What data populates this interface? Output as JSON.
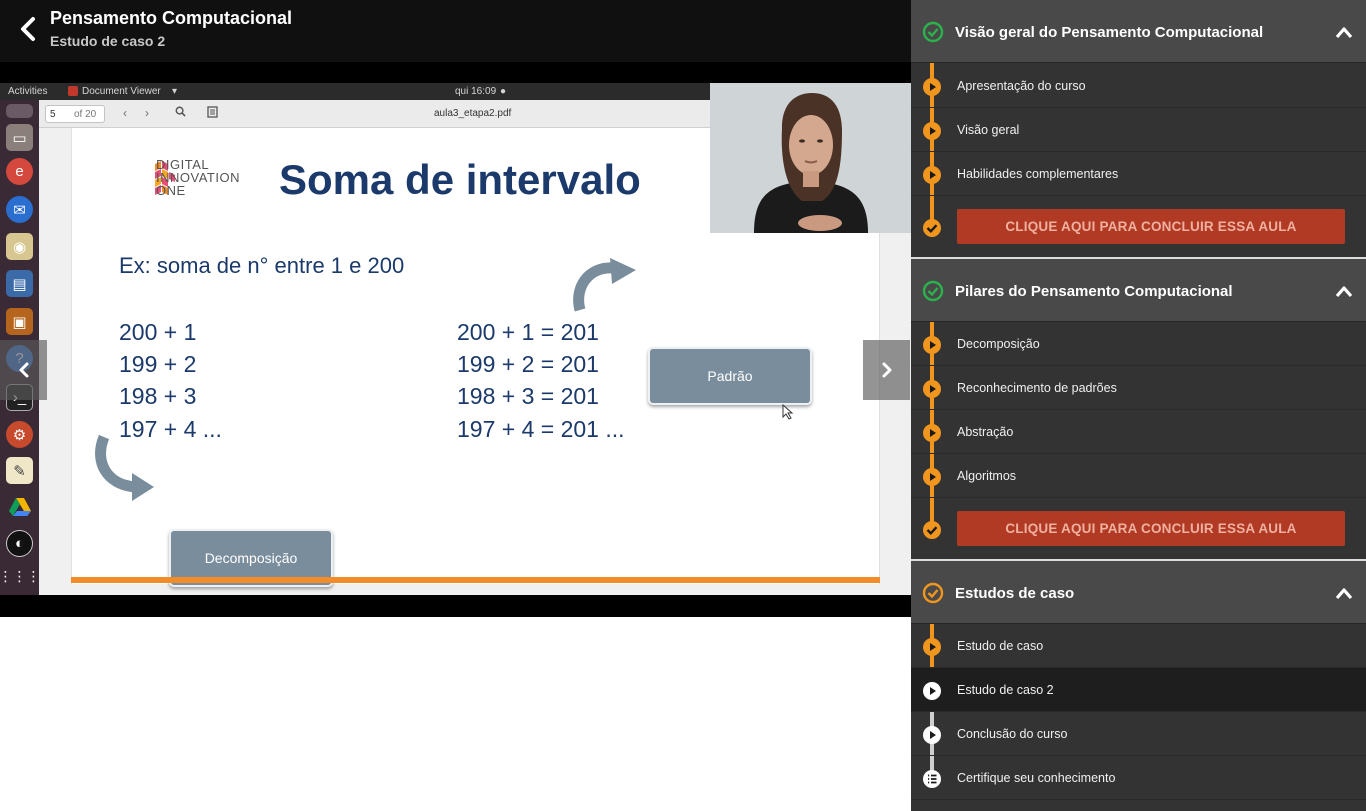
{
  "header": {
    "course_title": "Pensamento Computacional",
    "lesson_subtitle": "Estudo de caso 2"
  },
  "video": {
    "desktop_topbar": {
      "activities": "Activities",
      "app_name": "Document Viewer",
      "clock": "qui 16:09"
    },
    "viewer": {
      "page_number": "5",
      "page_total": "of 20",
      "file_name": "aula3_etapa2.pdf"
    },
    "slide": {
      "logo_lines": [
        "DIGITAL",
        "INNOVATION",
        "ONE"
      ],
      "title": "Soma de intervalo",
      "example": "Ex: soma de n° entre  1 e 200",
      "left_equations": [
        "200 + 1",
        "199 + 2",
        "198 + 3",
        "197 + 4 ..."
      ],
      "right_equations": [
        "200 + 1 = 201",
        "199 + 2 = 201",
        "198 + 3 = 201",
        "197 + 4 = 201 ..."
      ],
      "box_padrao": "Padrão",
      "box_decomposicao": "Decomposição"
    }
  },
  "sidebar": {
    "modules": [
      {
        "title": "Visão geral do Pensamento Computacional",
        "lessons": [
          "Apresentação do curso",
          "Visão geral",
          "Habilidades complementares"
        ],
        "complete_label": "CLIQUE AQUI PARA CONCLUIR ESSA AULA"
      },
      {
        "title": "Pilares do Pensamento Computacional",
        "lessons": [
          "Decomposição",
          "Reconhecimento de padrões",
          "Abstração",
          "Algoritmos"
        ],
        "complete_label": "CLIQUE AQUI PARA CONCLUIR ESSA AULA"
      },
      {
        "title": "Estudos de caso",
        "lessons": [
          "Estudo de caso",
          "Estudo de caso 2",
          "Conclusão do curso",
          "Certifique seu conhecimento"
        ]
      }
    ]
  },
  "colors": {
    "accent_orange": "#f0961e",
    "complete_green": "#2bb24c",
    "complete_button": "#b03a24",
    "slide_blue": "#1b3a6b"
  }
}
